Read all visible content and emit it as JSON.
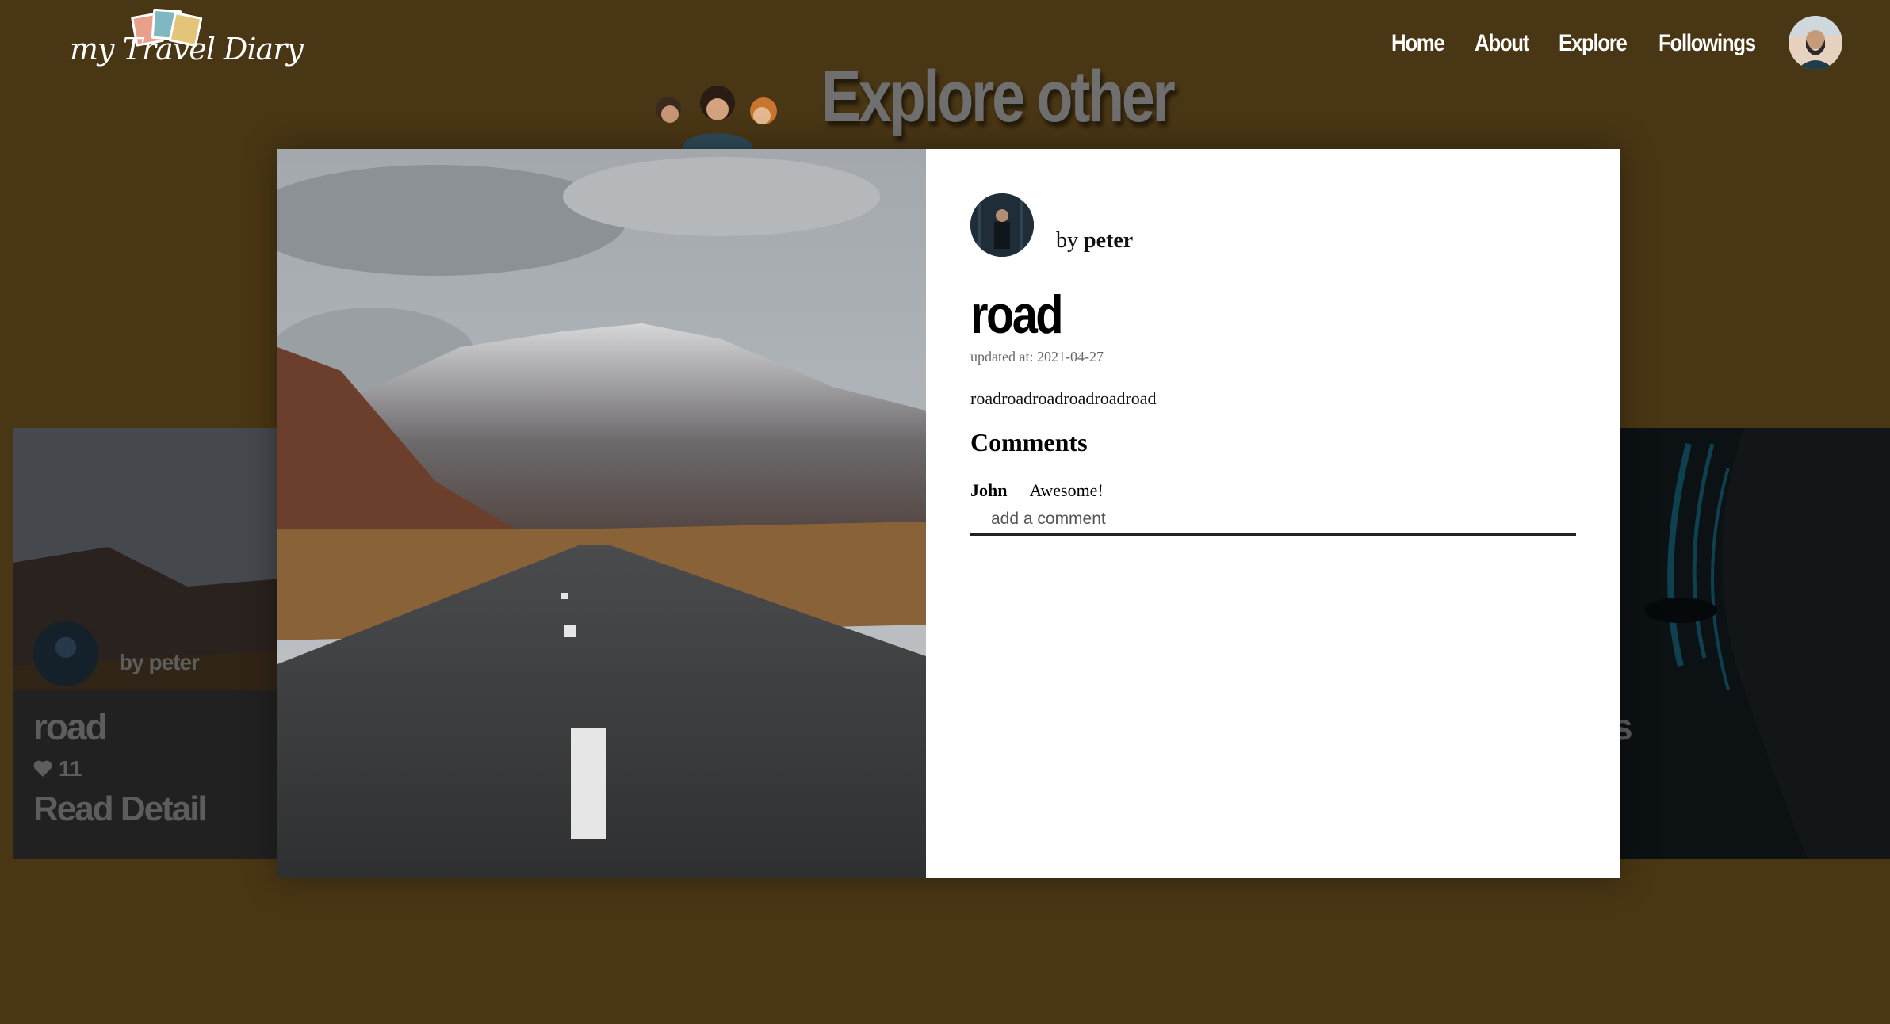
{
  "header": {
    "logo_text": "my Travel Diary",
    "nav": [
      "Home",
      "About",
      "Explore",
      "Followings"
    ],
    "avatar_icon": "user-avatar"
  },
  "page": {
    "heading": "Explore other"
  },
  "background_cards": {
    "left": {
      "by_prefix": "by",
      "author": "peter",
      "title": "road",
      "likes": "11",
      "read_label": "Read Detail"
    },
    "right": {
      "partial_text": "s"
    }
  },
  "modal": {
    "author_prefix": "by",
    "author": "peter",
    "title": "road",
    "updated": "updated at: 2021-04-27",
    "content": "roadroadroadroadroadroad",
    "comments_heading": "Comments",
    "comments": [
      {
        "author": "John",
        "text": "Awesome!"
      }
    ],
    "comment_placeholder": "add a comment"
  },
  "colors": {
    "background": "#493614",
    "modal": "#ffffff",
    "nav_text": "#ffffff",
    "heading_gray": "#6f6f6f"
  }
}
